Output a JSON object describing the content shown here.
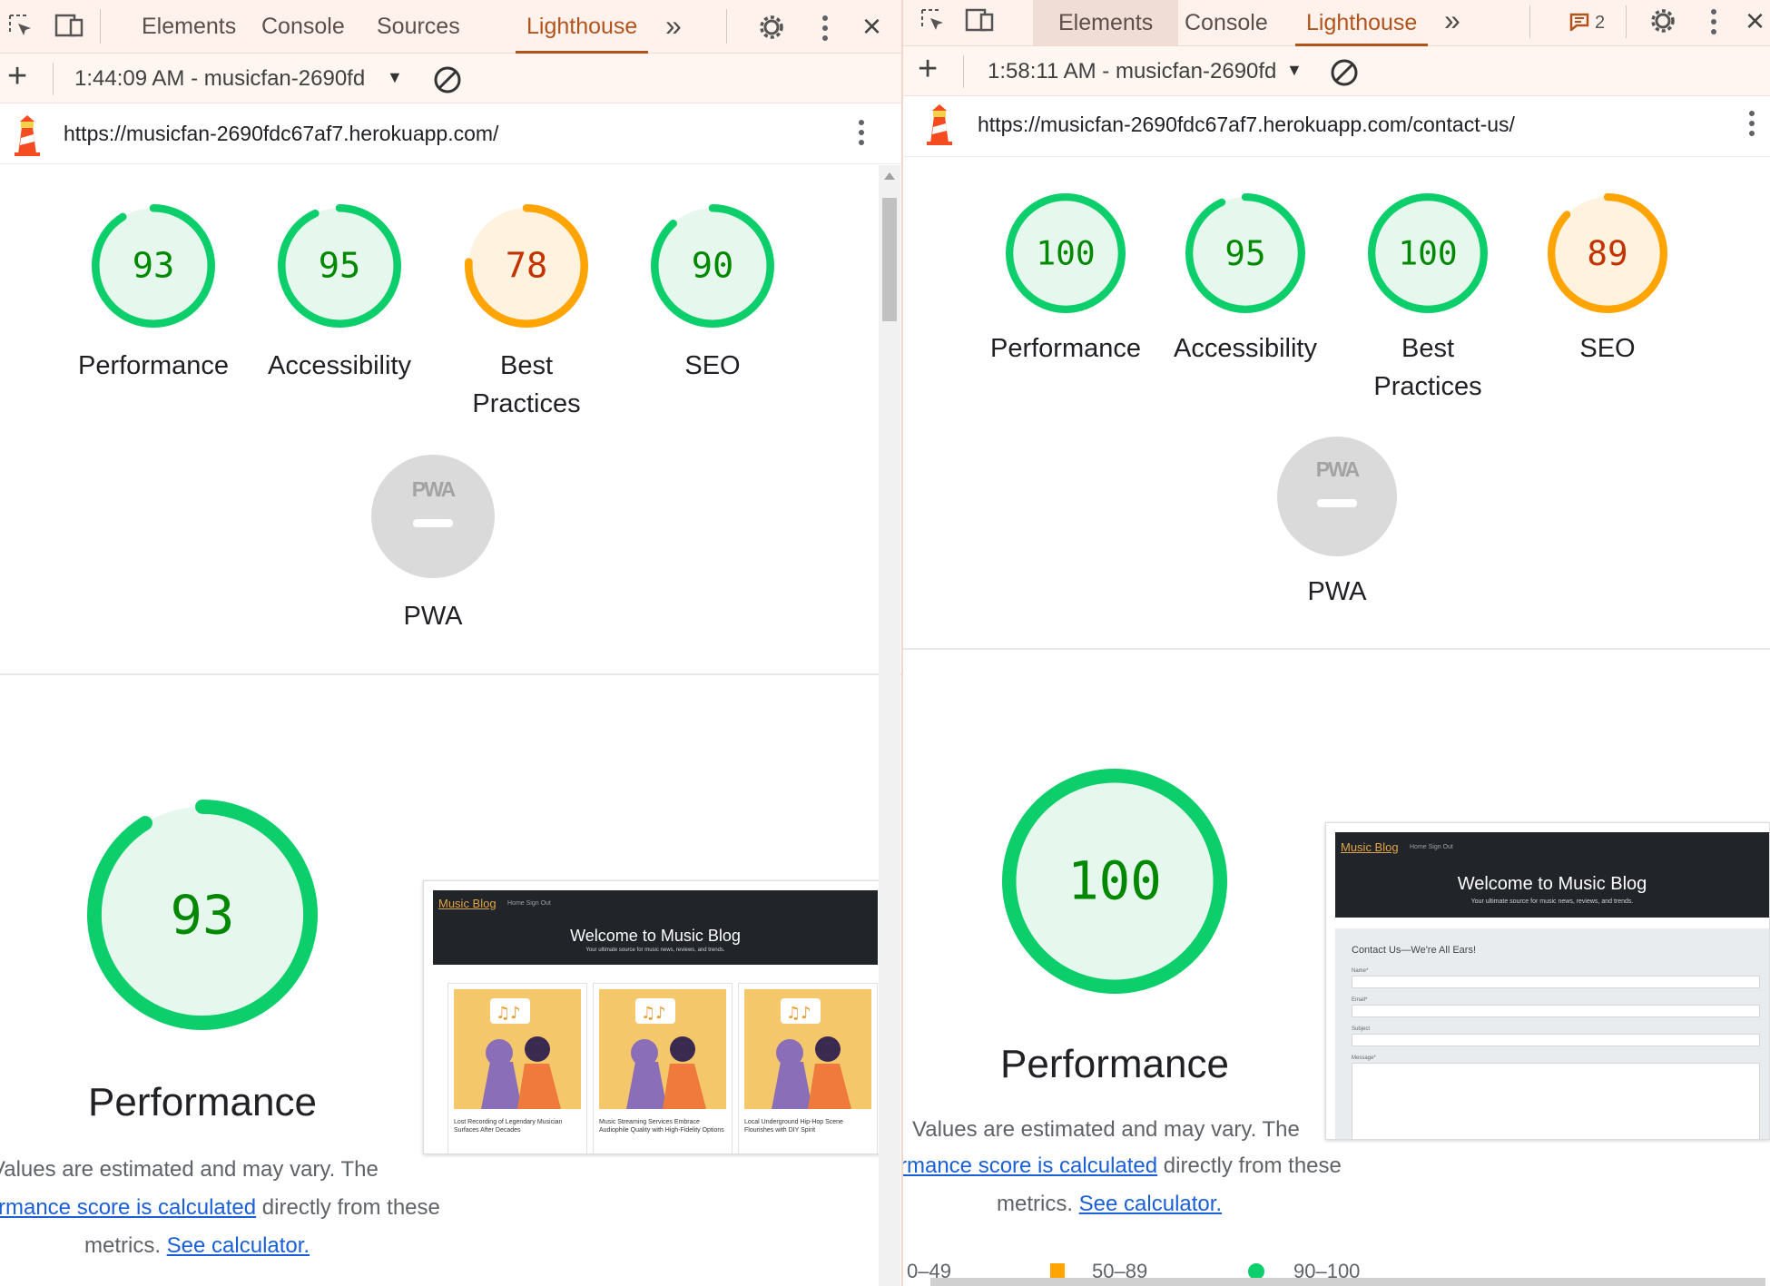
{
  "left": {
    "tabs": [
      "Elements",
      "Console",
      "Sources",
      "Lighthouse"
    ],
    "report_selector": "1:44:09 AM - musicfan-2690fd",
    "url": "https://musicfan-2690fdc67af7.herokuapp.com/",
    "scores": [
      {
        "value": "93",
        "label": "Performance",
        "score": 93
      },
      {
        "value": "95",
        "label": "Accessibility",
        "score": 95
      },
      {
        "value": "78",
        "label": "Best Practices",
        "score": 78
      },
      {
        "value": "90",
        "label": "SEO",
        "score": 90
      }
    ],
    "pwa": {
      "badge": "PWA",
      "label": "PWA"
    },
    "perf": {
      "value": "93",
      "score": 93,
      "title": "Performance"
    },
    "desc": {
      "line1": "Values are estimated and may vary. The",
      "link1": "rmance score is calculated",
      "line2_rest": " directly from these",
      "line3_pre": "metrics. ",
      "link2": "See calculator."
    },
    "thumb": {
      "brand": "Music Blog",
      "nav": "Home   Sign Out",
      "hero_title": "Welcome to Music Blog",
      "hero_sub": "Your ultimate source for music news, reviews, and trends.",
      "cards": [
        "Lost Recording of Legendary Musician Surfaces After Decades",
        "Music Streaming Services Embrace Audiophile Quality with High-Fidelity Options",
        "Local Underground Hip-Hop Scene Flourishes with DIY Spirit"
      ]
    }
  },
  "right": {
    "tabs": [
      "Elements",
      "Console",
      "Lighthouse"
    ],
    "issues_count": "2",
    "report_selector": "1:58:11 AM - musicfan-2690fd",
    "url": "https://musicfan-2690fdc67af7.herokuapp.com/contact-us/",
    "scores": [
      {
        "value": "100",
        "label": "Performance",
        "score": 100
      },
      {
        "value": "95",
        "label": "Accessibility",
        "score": 95
      },
      {
        "value": "100",
        "label": "Best Practices",
        "score": 100
      },
      {
        "value": "89",
        "label": "SEO",
        "score": 89
      }
    ],
    "pwa": {
      "badge": "PWA",
      "label": "PWA"
    },
    "perf": {
      "value": "100",
      "score": 100,
      "title": "Performance"
    },
    "desc": {
      "line1": "Values are estimated and may vary. The",
      "link1": "rmance score is calculated",
      "line2_rest": " directly from these",
      "line3_pre": "metrics. ",
      "link2": "See calculator."
    },
    "legend": [
      "0–49",
      "50–89",
      "90–100"
    ],
    "thumb": {
      "brand": "Music Blog",
      "nav": "Home   Sign Out",
      "hero_title": "Welcome to Music Blog",
      "hero_sub": "Your ultimate source for music news, reviews, and trends.",
      "form_title": "Contact Us—We're All Ears!",
      "fields": [
        "Name*",
        "Email*",
        "Subject",
        "Message*"
      ]
    }
  },
  "colors": {
    "pass": "#0cce6b",
    "pass_bg": "#e6f7ee",
    "pass_text": "#008800",
    "average": "#ffa400",
    "average_bg": "#fff3e0",
    "average_text": "#c33300",
    "fail": "#ff4e42",
    "pwa_bg": "#dadada",
    "accent": "#b3531c",
    "link": "#1a5fd6"
  },
  "icons": [
    "inspect-element-icon",
    "device-toolbar-icon",
    "more-tabs-icon",
    "settings-gear-icon",
    "kebab-menu-icon",
    "close-icon",
    "plus-icon",
    "clear-icon",
    "lighthouse-logo-icon",
    "issues-icon"
  ]
}
